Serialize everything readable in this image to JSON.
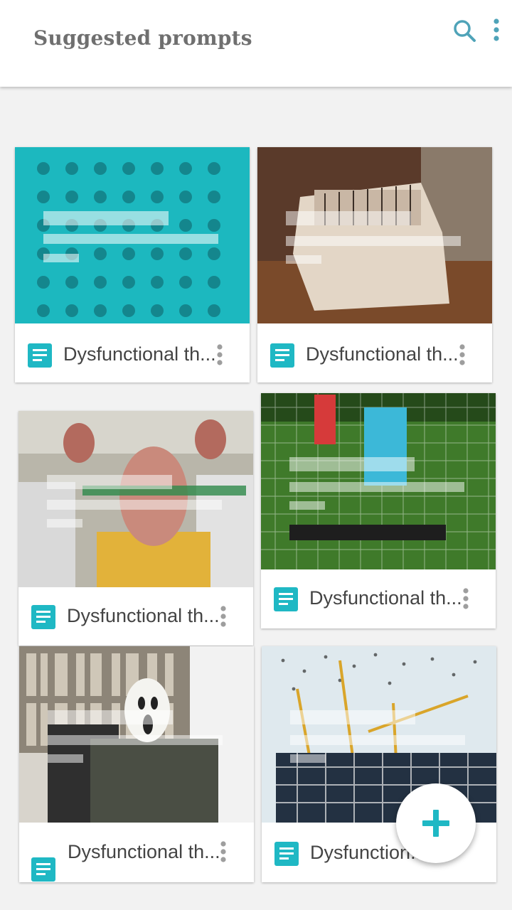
{
  "appbar": {
    "title": "Suggested prompts",
    "actions": [
      {
        "icon": "search-icon"
      },
      {
        "icon": "more-vert-icon"
      }
    ]
  },
  "colors": {
    "accent": "#1fb8c4",
    "icon_gray": "#4fa3b8",
    "menu_gray": "#9e9e9e"
  },
  "cards": [
    {
      "title": "Dysfunctional th...",
      "image": "calendar"
    },
    {
      "title": "Dysfunctional th...",
      "image": "typewriter"
    },
    {
      "title": "Dysfunctional th...",
      "image": "crash-test-dummies"
    },
    {
      "title": "Dysfunctional th...",
      "image": "football-goal"
    },
    {
      "title": "Dysfunctional th...",
      "image": "masked-office-worker"
    },
    {
      "title": "Dysfunction...",
      "image": "construction-cranes"
    }
  ],
  "fab": {
    "icon": "plus-icon"
  }
}
